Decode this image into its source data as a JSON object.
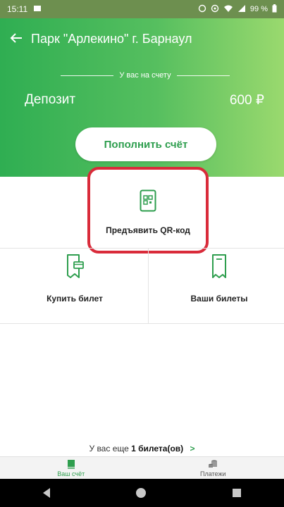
{
  "status_bar": {
    "time": "15:11",
    "battery": "99 %"
  },
  "header": {
    "title": "Парк \"Арлекино\" г. Барнаул",
    "account_caption": "У вас на счету",
    "deposit_label": "Депозит",
    "deposit_value": "600 ₽",
    "topup_label": "Пополнить счёт"
  },
  "actions": {
    "show_qr_label": "Предъявить QR-код",
    "buy_ticket_label": "Купить билет",
    "your_tickets_label": "Ваши билеты"
  },
  "tickets_left": {
    "prefix": "У вас еще",
    "count_text": "1 билета(ов)",
    "chevron": ">"
  },
  "bottom_nav": {
    "items": [
      {
        "label": "Ваш счёт",
        "icon": "wallet-icon",
        "active": true
      },
      {
        "label": "Платежи",
        "icon": "coins-icon",
        "active": false
      }
    ]
  },
  "colors": {
    "accent": "#2e9e4e",
    "highlight": "#d92b3a"
  }
}
